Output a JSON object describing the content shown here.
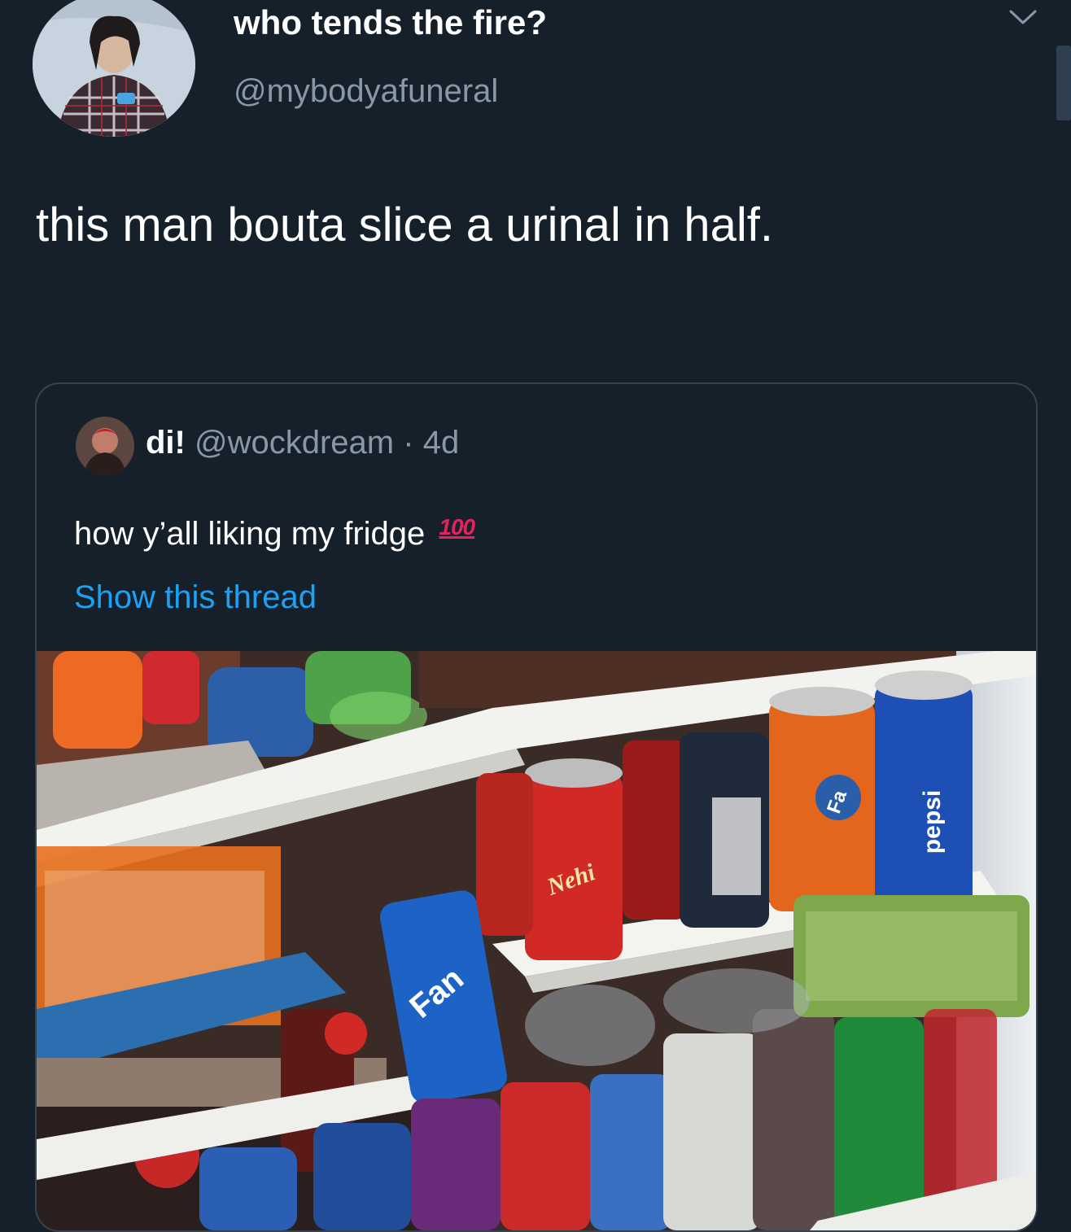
{
  "tweet": {
    "author_name": "who tends the fire?",
    "author_handle": "@mybodyafuneral",
    "text": "this man bouta slice a urinal in half."
  },
  "quoted_tweet": {
    "author_name": "di!",
    "author_handle": "@wockdream",
    "separator": "·",
    "time": "4d",
    "text": "how y’all liking my fridge",
    "emoji": "100",
    "show_thread_label": "Show this thread"
  },
  "media": {
    "can_labels": [
      "Nehi",
      "pepsi",
      "Fan",
      "Fa"
    ]
  },
  "colors": {
    "background": "#15202b",
    "secondary_text": "#8899a6",
    "link": "#1da1f2",
    "border": "#38444d"
  },
  "icons": {
    "menu": "chevron-down-icon"
  }
}
